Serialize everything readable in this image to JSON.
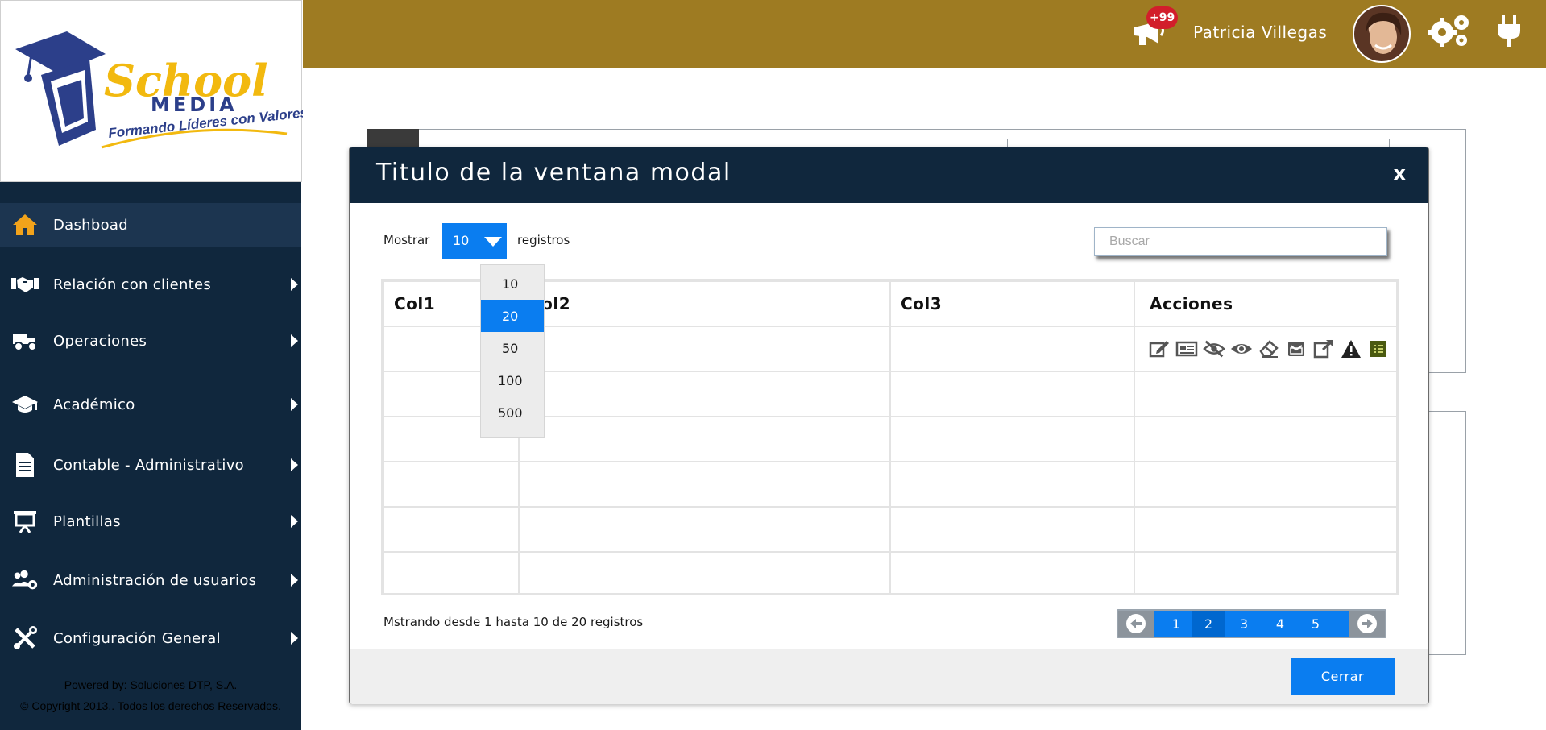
{
  "brand": {
    "logo_word1": "School",
    "logo_word2": "MEDIA",
    "logo_tagline": "Formando Líderes con Valores"
  },
  "header": {
    "user_name": "Patricia Villegas",
    "notification_badge": "+99",
    "icons": [
      "megaphone-icon",
      "avatar",
      "gear-icon",
      "plug-icon"
    ],
    "bar_color": "#9e7b22"
  },
  "sidebar": {
    "items": [
      {
        "label": "Dashboad",
        "icon": "home-icon",
        "active": true
      },
      {
        "label": "Relación con clientes",
        "icon": "handshake-icon"
      },
      {
        "label": "Operaciones",
        "icon": "truck-icon"
      },
      {
        "label": "Académico",
        "icon": "graduation-cap-icon"
      },
      {
        "label": "Contable - Administrativo",
        "icon": "document-icon"
      },
      {
        "label": "Plantillas",
        "icon": "presentation-icon"
      },
      {
        "label": "Administración de usuarios",
        "icon": "users-gear-icon"
      },
      {
        "label": "Configuración General",
        "icon": "tools-icon"
      }
    ],
    "footer_line1": "Powered by: Soluciones DTP, S.A.",
    "footer_line2": "© Copyright 2013.. Todos los derechos Reservados.",
    "bg_color": "#10273d"
  },
  "modal": {
    "title": "Titulo de la ventana modal",
    "close_label": "x",
    "show_label": "Mostrar",
    "records_label": "registros",
    "page_size_selected": "10",
    "page_size_options": [
      "10",
      "20",
      "50",
      "100",
      "500"
    ],
    "page_size_highlighted": "20",
    "search_placeholder": "Buscar",
    "search_value": "",
    "table": {
      "columns": [
        "Col1",
        "Col2",
        "Col3",
        "Acciones"
      ],
      "row_count": 6,
      "actions": [
        "edit-icon",
        "newspaper-icon",
        "eye-slash-icon",
        "eye-icon",
        "eraser-icon",
        "envelope-icon",
        "external-link-icon",
        "warning-icon",
        "list-icon"
      ]
    },
    "info_text": "Mstrando desde 1 hasta 10 de 20 registros",
    "pagination": {
      "pages": [
        "1",
        "2",
        "3",
        "4",
        "5"
      ],
      "active_page": "2"
    },
    "footer_button": "Cerrar",
    "accent_color": "#0a7df0"
  }
}
